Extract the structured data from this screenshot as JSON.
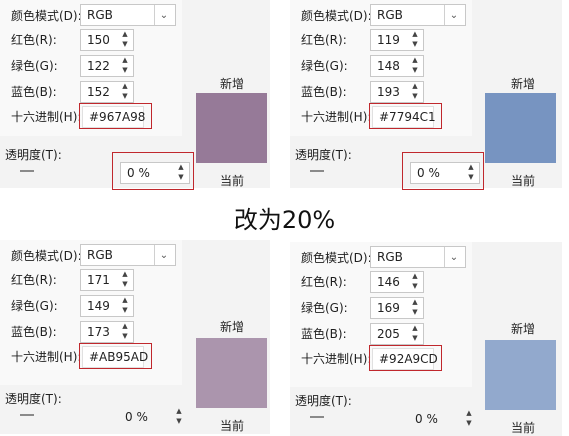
{
  "labels": {
    "color_model": "颜色模式(D):",
    "red": "红色(R):",
    "green": "绿色(G):",
    "blue": "蓝色(B):",
    "hex": "十六进制(H):",
    "transparency": "透明度(T):",
    "new": "新增",
    "current": "当前"
  },
  "caption": "改为20%",
  "panels": [
    {
      "model": "RGB",
      "r": "150",
      "g": "122",
      "b": "152",
      "hex": "#967A98",
      "transparency": "0 %",
      "new_color": "#967A98",
      "current_color": "#967A98"
    },
    {
      "model": "RGB",
      "r": "119",
      "g": "148",
      "b": "193",
      "hex": "#7794C1",
      "transparency": "0 %",
      "new_color": "#7794C1",
      "current_color": "#7794C1"
    },
    {
      "model": "RGB",
      "r": "171",
      "g": "149",
      "b": "173",
      "hex": "#AB95AD",
      "transparency": "0 %",
      "new_color": "#AB95AD",
      "current_color": "#AB95AD"
    },
    {
      "model": "RGB",
      "r": "146",
      "g": "169",
      "b": "205",
      "hex": "#92A9CD",
      "transparency": "0 %",
      "new_color": "#92A9CD",
      "current_color": "#92A9CD"
    }
  ],
  "highlight_color": "#c0282d"
}
